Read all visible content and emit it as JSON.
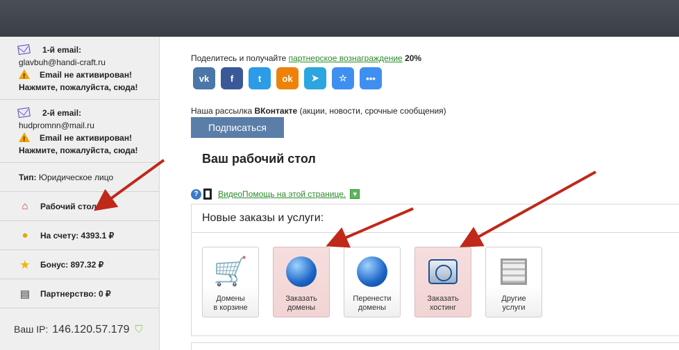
{
  "sidebar": {
    "email1": {
      "label": "1-й email:",
      "address": "glavbuh@handi-craft.ru",
      "warning": "Email не активирован!",
      "action": "Нажмите, пожалуйста, сюда!"
    },
    "email2": {
      "label": "2-й email:",
      "address": "hudpromnn@mail.ru",
      "warning": "Email не активирован!",
      "action": "Нажмите, пожалуйста, сюда!"
    },
    "type_label": "Тип:",
    "type_value": "Юридическое лицо",
    "desktop": "Рабочий стол",
    "balance": "На счету: 4393.1 ₽",
    "bonus": "Бонус: 897.32 ₽",
    "partnership": "Партнерство: 0 ₽",
    "ip_label": "Ваш IP:",
    "ip_value": "146.120.57.179"
  },
  "main": {
    "share_text": "Поделитесь и получайте",
    "share_link": "партнерское вознаграждение",
    "share_percent": "20%",
    "social": [
      {
        "name": "vk",
        "glyph": "vk",
        "color": "#4a76a8"
      },
      {
        "name": "facebook",
        "glyph": "f",
        "color": "#3b5998"
      },
      {
        "name": "twitter",
        "glyph": "t",
        "color": "#2c9be8"
      },
      {
        "name": "odnoklassniki",
        "glyph": "ok",
        "color": "#ee8208"
      },
      {
        "name": "telegram",
        "glyph": "➤",
        "color": "#2ca5e0"
      },
      {
        "name": "favorites",
        "glyph": "☆",
        "color": "#3f8ff0"
      },
      {
        "name": "more",
        "glyph": "•••",
        "color": "#3f8ff0"
      }
    ],
    "newsletter_prefix": "Наша рассылка",
    "newsletter_bold": "ВКонтакте",
    "newsletter_suffix": "(акции, новости, срочные сообщения)",
    "subscribe_label": "Подписаться",
    "page_title": "Ваш рабочий стол",
    "video_help": "ВидеоПомощь на этой странице.",
    "panel_title": "Новые заказы и услуги:",
    "tiles": [
      {
        "line1": "Домены",
        "line2": "в корзине"
      },
      {
        "line1": "Заказать",
        "line2": "домены"
      },
      {
        "line1": "Перенести",
        "line2": "домены"
      },
      {
        "line1": "Заказать",
        "line2": "хостинг"
      },
      {
        "line1": "Другие",
        "line2": "услуги"
      }
    ]
  }
}
